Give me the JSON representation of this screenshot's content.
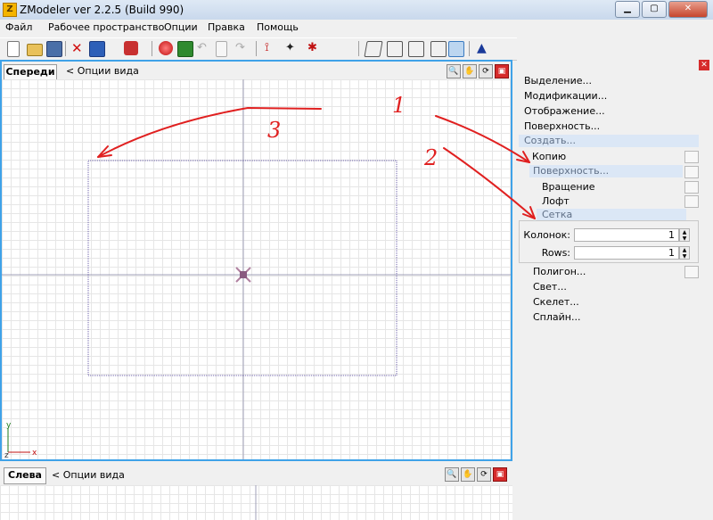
{
  "window": {
    "title": "ZModeler ver 2.2.5 (Build 990)",
    "app_icon": "Z"
  },
  "window_controls": {
    "minimize": "▁",
    "maximize": "▢",
    "close": "✕"
  },
  "menu": [
    "Файл",
    "Рабочее пространство",
    "Опции",
    "Правка",
    "Помощь"
  ],
  "toolbar_icons": [
    "new-icon",
    "open-icon",
    "save-icon",
    "delete-icon",
    "import-icon",
    "undo-history-icon",
    "record-icon",
    "render-icon",
    "undo-icon",
    "document-icon",
    "redo-icon",
    "select-vertex-icon",
    "select-move-icon",
    "select-object-icon",
    "vertex-mode-icon",
    "face-mode-icon",
    "object-mode-icon",
    "box-mode-icon",
    "blue-arrow-icon"
  ],
  "viewport_top": {
    "tab": "Спереди",
    "options": "<  Опции вида",
    "axis_y": "y",
    "axis_z": "z",
    "axis_x": "x"
  },
  "viewport_bottom": {
    "tab": "Слева",
    "options": "<  Опции вида"
  },
  "viewport_icons": [
    "zoom-icon",
    "pan-icon",
    "rotate-icon",
    "maximize-icon"
  ],
  "panel": {
    "top_items": [
      "Выделение...",
      "Модификации...",
      "Отображение...",
      "Поверхность..."
    ],
    "create": "Создать...",
    "create_sub": {
      "copy": "Копию",
      "surface": "Поверхность...",
      "rotation": "Вращение",
      "loft": "Лофт",
      "grid": "Сетка"
    },
    "fields": [
      {
        "label": "Колонок:",
        "value": "1"
      },
      {
        "label": "Rows:",
        "value": "1"
      }
    ],
    "after_items": [
      "Полигон...",
      "Свет...",
      "Скелет...",
      "Сплайн..."
    ]
  },
  "annotations": [
    "1",
    "2",
    "3"
  ],
  "colors": {
    "viewport_border": "#3fa2e8",
    "annotation": "#e02020",
    "selection": "#6b5fa8",
    "highlight": "#dbe7f6"
  }
}
